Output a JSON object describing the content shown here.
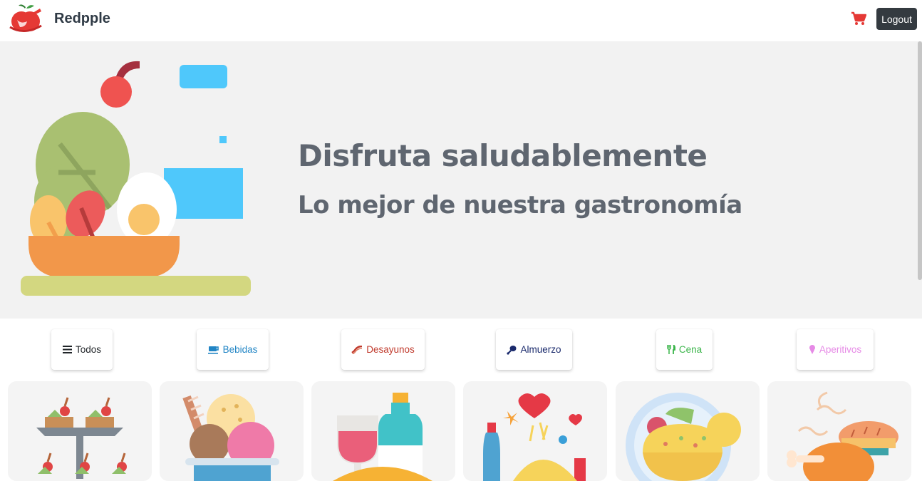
{
  "brand": {
    "name": "Redpple"
  },
  "nav": {
    "logout_label": "Logout"
  },
  "hero": {
    "title": "Disfruta saludablemente",
    "subtitle": "Lo mejor de nuestra gastronomía"
  },
  "categories": [
    {
      "label": "Todos",
      "icon": "menu-icon",
      "color": "#212529"
    },
    {
      "label": "Bebidas",
      "icon": "coffee-cup-icon",
      "color": "#2185c5"
    },
    {
      "label": "Desayunos",
      "icon": "bacon-icon",
      "color": "#c0392b"
    },
    {
      "label": "Almuerzo",
      "icon": "drumstick-icon",
      "color": "#1a2a6c"
    },
    {
      "label": "Cena",
      "icon": "utensils-icon",
      "color": "#3bb54a"
    },
    {
      "label": "Aperitivos",
      "icon": "ice-cream-icon",
      "color": "#e68ae6"
    }
  ],
  "cards": [
    {
      "icon": "canapes-icon"
    },
    {
      "icon": "ice-cream-dessert-icon"
    },
    {
      "icon": "wine-bottle-icon"
    },
    {
      "icon": "romantic-dinner-icon"
    },
    {
      "icon": "taco-plate-icon"
    },
    {
      "icon": "roast-chicken-icon"
    }
  ],
  "colors": {
    "brand_red": "#e53935",
    "navbar_dark": "#343a40",
    "hero_bg": "#f2f2f2",
    "hero_text": "#5f6670"
  }
}
